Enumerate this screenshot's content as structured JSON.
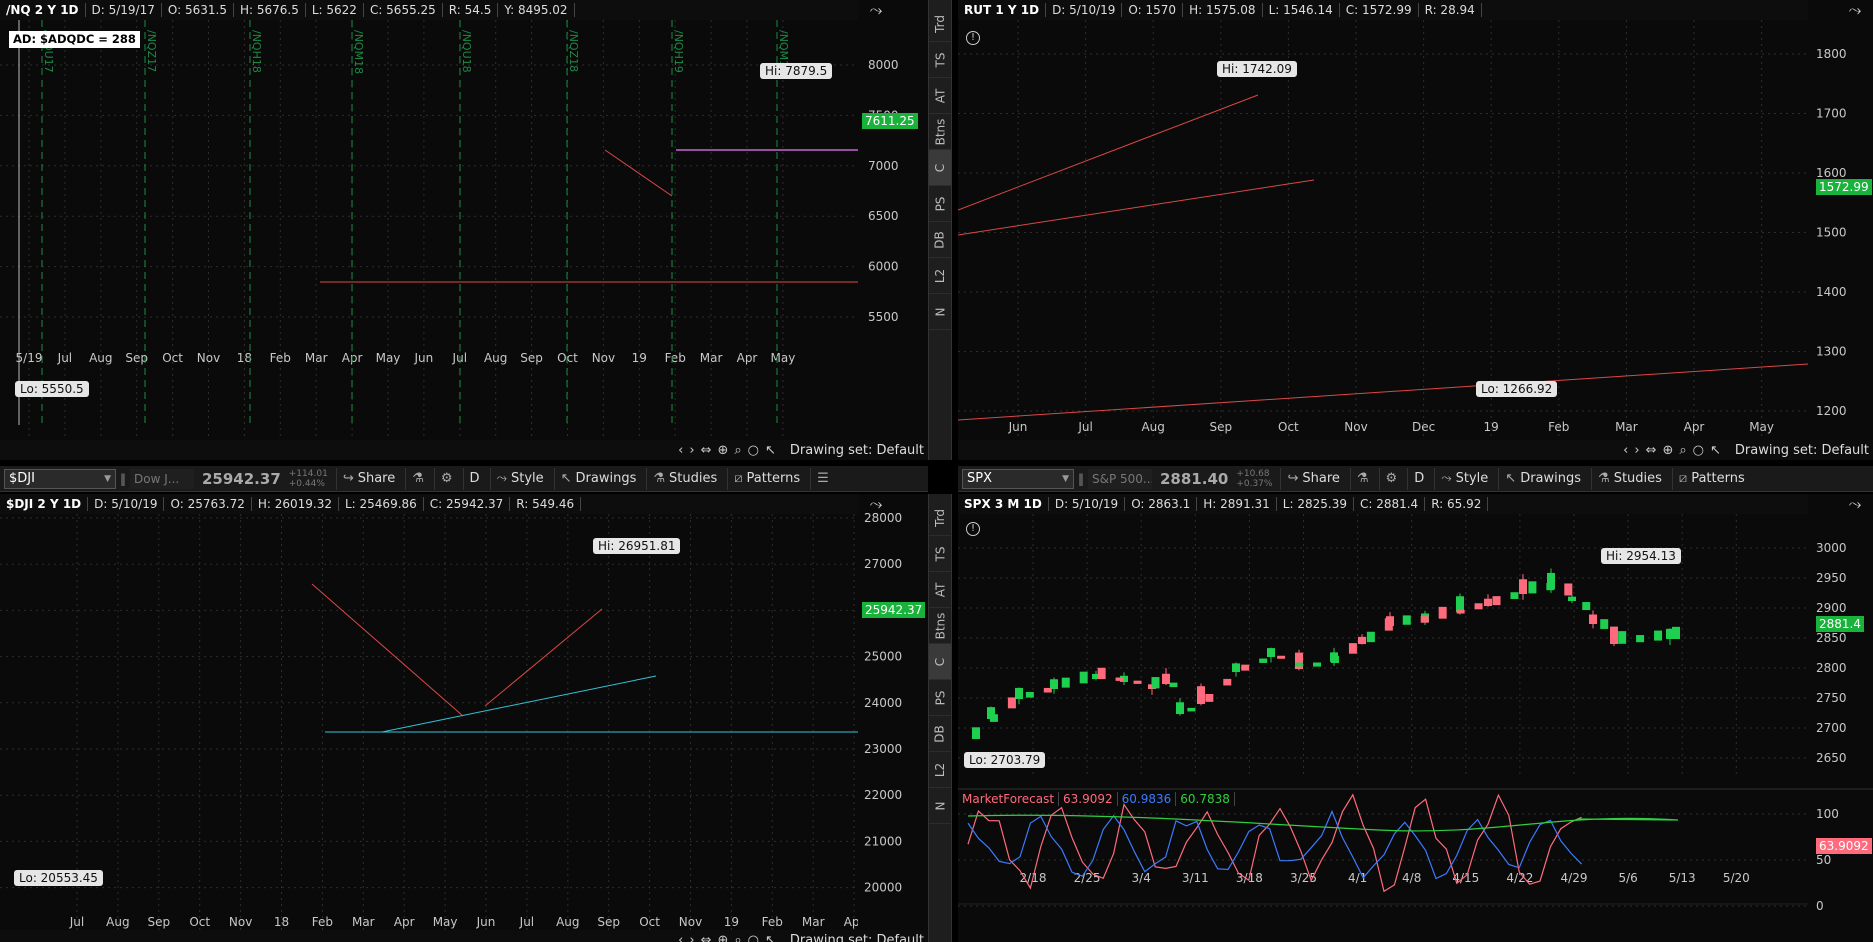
{
  "colors": {
    "up": "#1fcf4f",
    "down": "#ff6b7d",
    "trend": "#d94848",
    "cyan": "#33c3d6",
    "magenta": "#c464d0",
    "grid": "#2d2d2d",
    "price_green": "#19b23b"
  },
  "sidebar_tabs": [
    "Trd",
    "TS",
    "AT",
    "Btns",
    "C",
    "PS",
    "DB",
    "L2",
    "N"
  ],
  "drawing_set_label": "Drawing set: Default",
  "chart1": {
    "header": [
      "/NQ 2 Y 1D",
      "D: 5/19/17",
      "O: 5631.5",
      "H: 5676.5",
      "L: 5622",
      "C: 5655.25",
      "R: 54.5",
      "Y: 8495.02"
    ],
    "ad_label": "AD: $ADQDC = 288",
    "price_tag": "7611.25",
    "hi_label": "Hi: 7879.5",
    "lo_label": "Lo: 5550.5",
    "expiry_labels": [
      "/NQU17",
      "/NQZ17",
      "/NQH18",
      "/NQM18",
      "/NQU18",
      "/NQZ18",
      "/NQH19",
      "/NQM19"
    ],
    "y_ticks": [
      "8000",
      "7500",
      "7000",
      "6500",
      "6000",
      "5500"
    ],
    "x_ticks": [
      "5/19",
      "Jul",
      "Aug",
      "Sep",
      "Oct",
      "Nov",
      "18",
      "Feb",
      "Mar",
      "Apr",
      "May",
      "Jun",
      "Jul",
      "Aug",
      "Sep",
      "Oct",
      "Nov",
      "19",
      "Feb",
      "Mar",
      "Apr",
      "May"
    ]
  },
  "chart2": {
    "header": [
      "RUT 1 Y 1D",
      "D: 5/10/19",
      "O: 1570",
      "H: 1575.08",
      "L: 1546.14",
      "C: 1572.99",
      "R: 28.94"
    ],
    "price_tag": "1572.99",
    "hi_label": "Hi: 1742.09",
    "lo_label": "Lo: 1266.92",
    "y_ticks": [
      "1800",
      "1700",
      "1600",
      "1500",
      "1400",
      "1300",
      "1200"
    ],
    "x_ticks": [
      "Jun",
      "Jul",
      "Aug",
      "Sep",
      "Oct",
      "Nov",
      "Dec",
      "19",
      "Feb",
      "Mar",
      "Apr",
      "May"
    ]
  },
  "chart3": {
    "toolbar": {
      "symbol": "$DJI",
      "desc": "Dow J...",
      "price": "25942.37",
      "chg1": "+114.01",
      "chg2": "+0.44%",
      "share": "Share",
      "period": "D",
      "style": "Style",
      "drawings": "Drawings",
      "studies": "Studies",
      "patterns": "Patterns"
    },
    "header": [
      "$DJI 2 Y 1D",
      "D: 5/10/19",
      "O: 25763.72",
      "H: 26019.32",
      "L: 25469.86",
      "C: 25942.37",
      "R: 549.46"
    ],
    "price_tag": "25942.37",
    "hi_label": "Hi: 26951.81",
    "lo_label": "Lo: 20553.45",
    "y_ticks": [
      "28000",
      "27000",
      "26000",
      "25000",
      "24000",
      "23000",
      "22000",
      "21000",
      "20000"
    ],
    "x_ticks": [
      "Jul",
      "Aug",
      "Sep",
      "Oct",
      "Nov",
      "18",
      "Feb",
      "Mar",
      "Apr",
      "May",
      "Jun",
      "Jul",
      "Aug",
      "Sep",
      "Oct",
      "Nov",
      "19",
      "Feb",
      "Mar",
      "Apr"
    ]
  },
  "chart4": {
    "toolbar": {
      "symbol": "SPX",
      "desc": "S&P 500...",
      "price": "2881.40",
      "chg1": "+10.68",
      "chg2": "+0.37%",
      "share": "Share",
      "period": "D",
      "style": "Style",
      "drawings": "Drawings",
      "studies": "Studies",
      "patterns": "Patterns"
    },
    "header": [
      "SPX 3 M 1D",
      "D: 5/10/19",
      "O: 2863.1",
      "H: 2891.31",
      "L: 2825.39",
      "C: 2881.4",
      "R: 65.92"
    ],
    "price_tag": "2881.4",
    "hi_label": "Hi: 2954.13",
    "lo_label": "Lo: 2703.79",
    "y_ticks": [
      "3000",
      "2950",
      "2900",
      "2850",
      "2800",
      "2750",
      "2700",
      "2650"
    ],
    "study": {
      "name": "MarketForecast",
      "v1": "63.9092",
      "v2": "60.9836",
      "v3": "60.7838",
      "tag": "63.9092",
      "y_ticks": [
        "100",
        "50",
        "0"
      ]
    },
    "x_ticks": [
      "2/18",
      "2/25",
      "3/4",
      "3/11",
      "3/18",
      "3/25",
      "4/1",
      "4/8",
      "4/15",
      "4/22",
      "4/29",
      "5/6",
      "5/13",
      "5/20"
    ]
  }
}
